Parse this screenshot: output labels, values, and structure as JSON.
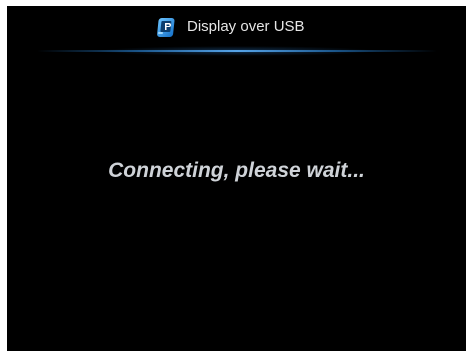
{
  "window": {
    "title": "Display over USB",
    "icon": "display-app-icon",
    "accent_color": "#2a8ee6"
  },
  "main": {
    "status_message": "Connecting, please wait..."
  },
  "colors": {
    "background": "#000000",
    "title_text": "#e6e6e6",
    "status_text": "#cfd3d8"
  }
}
